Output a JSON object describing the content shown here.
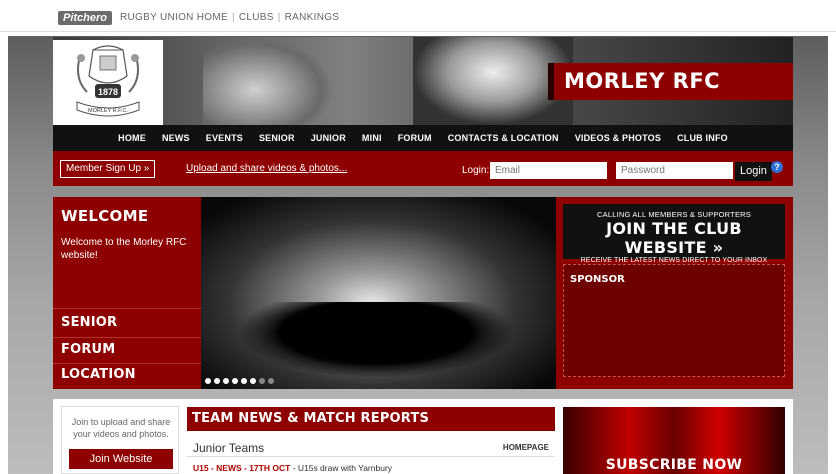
{
  "topbar": {
    "logo": "Pitchero",
    "links": [
      "RUGBY UNION HOME",
      "CLUBS",
      "RANKINGS"
    ]
  },
  "header": {
    "crest_icon": "morley-rfc-crest-icon",
    "crest_year": "1878",
    "crest_motto": "MORLEY R.F.C.",
    "club_name": "MORLEY RFC"
  },
  "nav": {
    "items": [
      "HOME",
      "NEWS",
      "EVENTS",
      "SENIOR",
      "JUNIOR",
      "MINI",
      "FORUM",
      "CONTACTS & LOCATION",
      "VIDEOS & PHOTOS",
      "CLUB INFO"
    ]
  },
  "loginbar": {
    "member_signup": "Member Sign Up »",
    "upload_link": "Upload and share videos & photos...",
    "login_label": "Login:",
    "email_placeholder": "Email",
    "password_placeholder": "Password",
    "login_button": "Login",
    "help": "?"
  },
  "welcome": {
    "title": "WELCOME",
    "text": "Welcome to the Morley RFC website!",
    "links": [
      "SENIOR",
      "FORUM",
      "LOCATION"
    ]
  },
  "hero": {
    "slides_total": 8,
    "active_slide": 6
  },
  "join": {
    "line1": "CALLING ALL MEMBERS & SUPPORTERS",
    "line2": "JOIN THE CLUB WEBSITE »",
    "line3": "RECEIVE THE LATEST NEWS DIRECT TO YOUR INBOX"
  },
  "sponsor": {
    "title": "SPONSOR"
  },
  "uploadbox": {
    "text": "Join to upload and share your videos and photos.",
    "button": "Join Website"
  },
  "news": {
    "title": "TEAM NEWS & MATCH REPORTS",
    "section": "Junior Teams",
    "homepage": "HOMEPAGE",
    "item_tag": "U15 - NEWS - 17TH OCT",
    "item_text": " - U15s draw with Yarnbury"
  },
  "subscribe": {
    "label": "SUBSCRIBE NOW"
  },
  "colors": {
    "brand_red": "#8e0000",
    "nav_black": "#111111",
    "link_red": "#b00000"
  }
}
